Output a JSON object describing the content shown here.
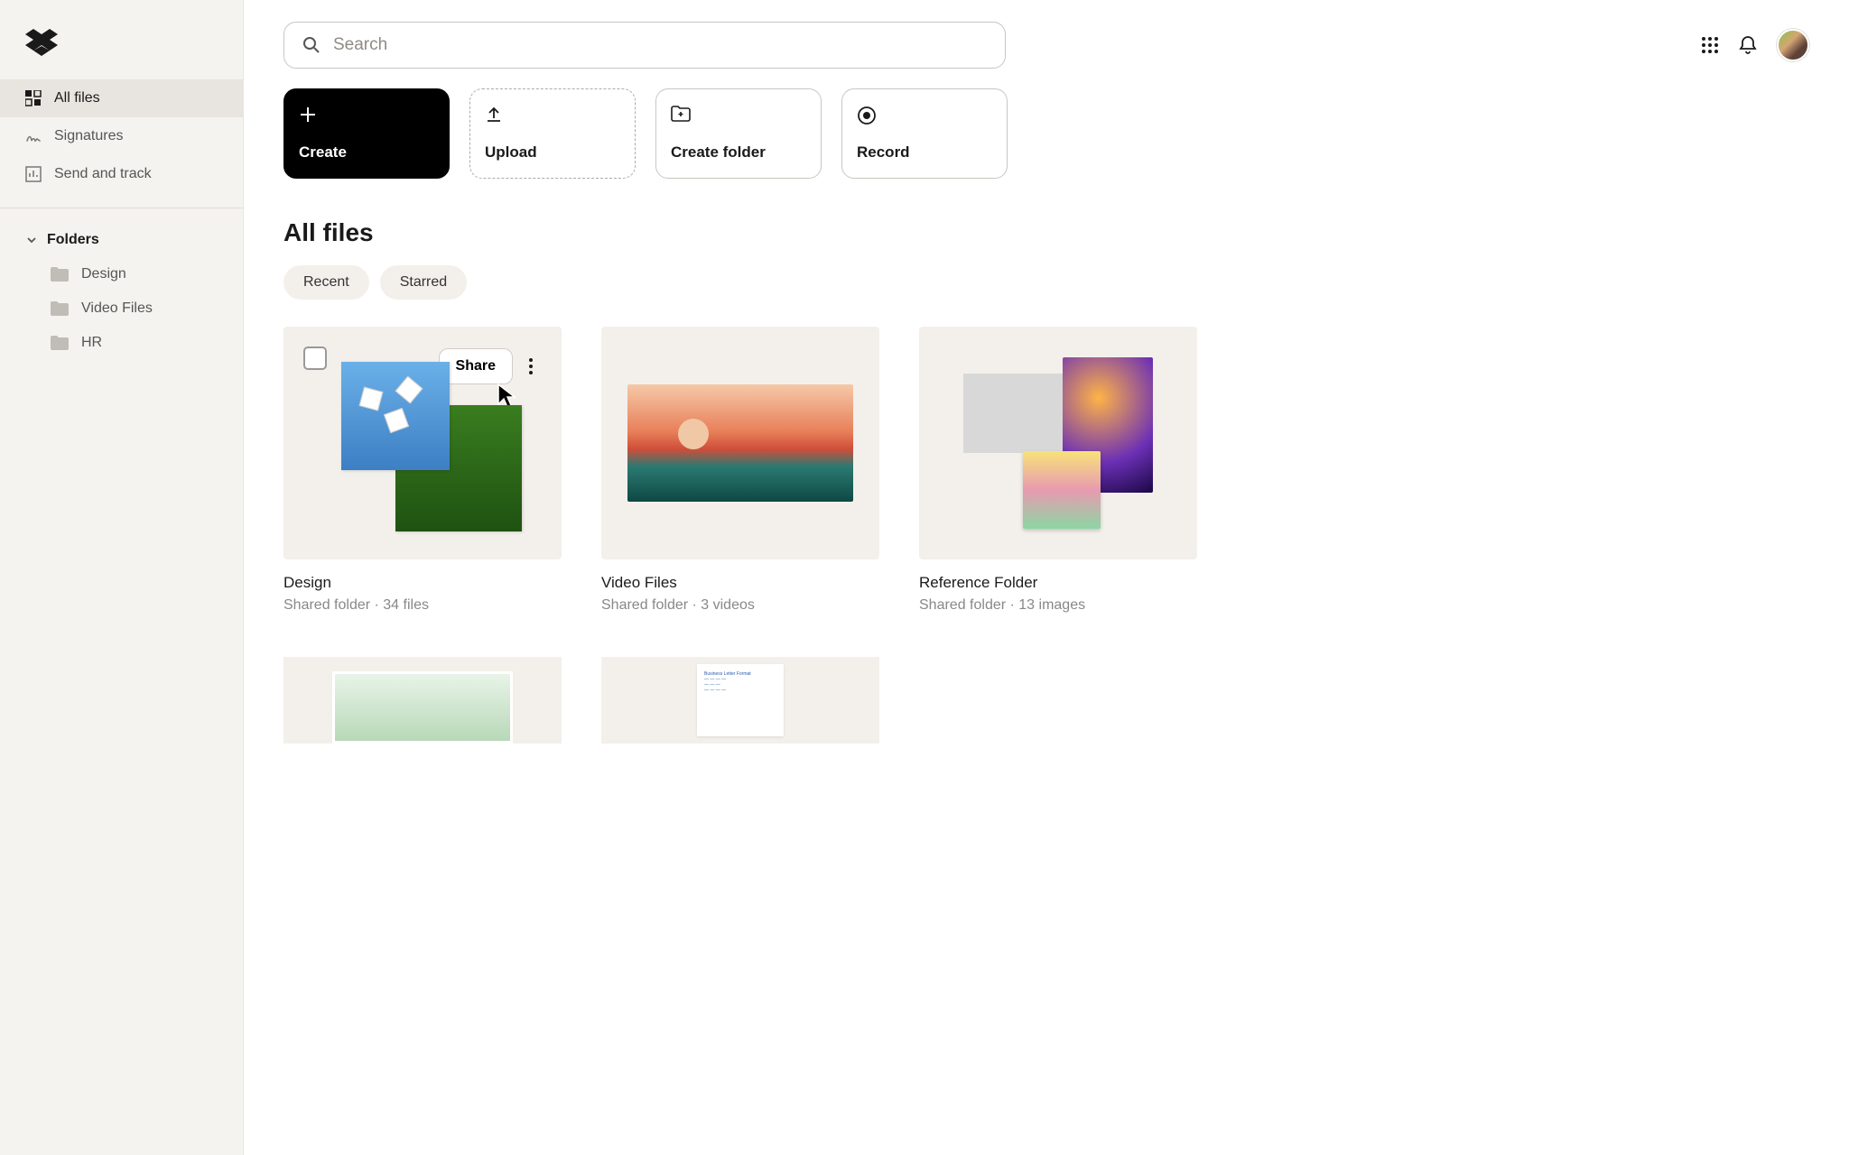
{
  "search": {
    "placeholder": "Search"
  },
  "sidebar": {
    "nav": [
      {
        "label": "All files"
      },
      {
        "label": "Signatures"
      },
      {
        "label": "Send and track"
      }
    ],
    "folders_header": "Folders",
    "folders": [
      {
        "label": "Design"
      },
      {
        "label": "Video Files"
      },
      {
        "label": "HR"
      }
    ]
  },
  "actions": {
    "create": "Create",
    "upload": "Upload",
    "create_folder": "Create folder",
    "record": "Record"
  },
  "page_title": "All files",
  "chips": {
    "recent": "Recent",
    "starred": "Starred"
  },
  "hover": {
    "share": "Share"
  },
  "cards": [
    {
      "name": "Design",
      "meta": "Shared folder · 34 files"
    },
    {
      "name": "Video Files",
      "meta": "Shared folder · 3 videos"
    },
    {
      "name": "Reference Folder",
      "meta": "Shared folder · 13 images"
    }
  ]
}
